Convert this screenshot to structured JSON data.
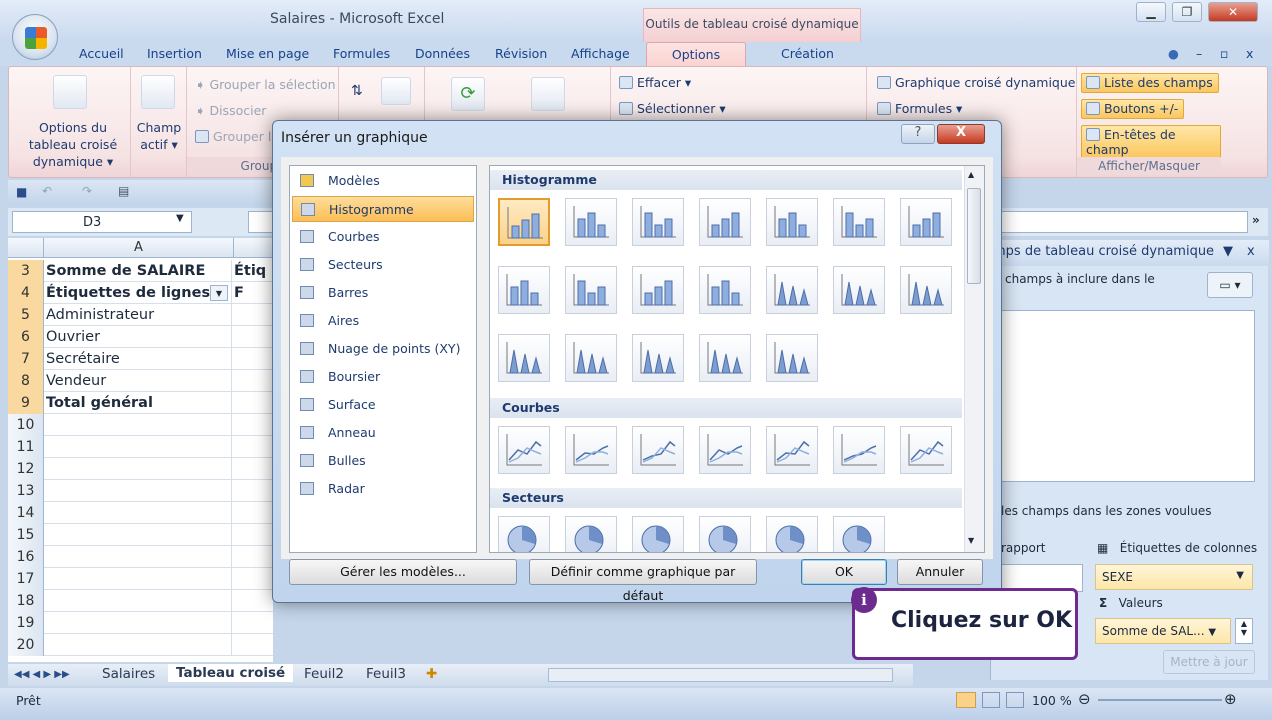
{
  "window": {
    "title": "Salaires - Microsoft Excel",
    "context_tab": "Outils de tableau croisé dynamique"
  },
  "tabs": [
    "Accueil",
    "Insertion",
    "Mise en page",
    "Formules",
    "Données",
    "Révision",
    "Affichage",
    "Options",
    "Création"
  ],
  "ribbon": {
    "options_tableau": "Options du tableau croisé dynamique ▾",
    "champ_actif": "Champ actif ▾",
    "grouper_selection": "Grouper la sélection",
    "dissocier": "Dissocier",
    "grouper": "Grouper le",
    "group_label": "Groupe",
    "effacer": "Effacer ▾",
    "selectionner": "Sélectionner ▾",
    "graphique": "Graphique croisé dynamique",
    "formules": "Formules ▾",
    "liste_champs": "Liste des champs",
    "boutons": "Boutons +/-",
    "entetes": "En-têtes de champ",
    "afficher_masquer": "Afficher/Masquer"
  },
  "formula_bar": {
    "name_box": "D3"
  },
  "sheet": {
    "column": "A",
    "rows": [
      {
        "n": "3",
        "a": "Somme de SALAIRE",
        "b": "Étiq",
        "bold": true
      },
      {
        "n": "4",
        "a": "Étiquettes de lignes",
        "b": "F",
        "bold": true
      },
      {
        "n": "5",
        "a": "Administrateur"
      },
      {
        "n": "6",
        "a": "Ouvrier"
      },
      {
        "n": "7",
        "a": "Secrétaire"
      },
      {
        "n": "8",
        "a": "Vendeur"
      },
      {
        "n": "9",
        "a": "Total général",
        "bold": true
      },
      {
        "n": "10"
      },
      {
        "n": "11"
      },
      {
        "n": "12"
      },
      {
        "n": "13"
      },
      {
        "n": "14"
      },
      {
        "n": "15"
      },
      {
        "n": "16"
      },
      {
        "n": "17"
      },
      {
        "n": "18"
      },
      {
        "n": "19"
      },
      {
        "n": "20"
      }
    ]
  },
  "sheet_tabs": [
    "Salaires",
    "Tableau croisé",
    "Feuil2",
    "Feuil3"
  ],
  "status": {
    "left": "Prêt",
    "zoom": "100 %"
  },
  "pane": {
    "title": "mps de tableau croisé dynamique",
    "choose": "champs à inclure dans le",
    "drag": "les champs dans les zones voulues",
    "rapport": "rapport",
    "col_labels": "Étiquettes de colonnes",
    "col_value": "SEXE",
    "values": "Valeurs",
    "values_value": "Somme de SAL...",
    "update": "Mettre à jour"
  },
  "dialog": {
    "title": "Insérer un graphique",
    "types": [
      "Modèles",
      "Histogramme",
      "Courbes",
      "Secteurs",
      "Barres",
      "Aires",
      "Nuage de points (XY)",
      "Boursier",
      "Surface",
      "Anneau",
      "Bulles",
      "Radar"
    ],
    "selected_type": "Histogramme",
    "sections": [
      {
        "title": "Histogramme",
        "count": 19
      },
      {
        "title": "Courbes",
        "count": 7
      },
      {
        "title": "Secteurs",
        "count": 6
      }
    ],
    "manage": "Gérer les modèles...",
    "set_default": "Définir comme graphique par défaut",
    "ok": "OK",
    "cancel": "Annuler"
  },
  "callout": {
    "text": "Cliquez sur OK",
    "icon": "i"
  },
  "colors": {
    "accent": "#6d2b8f",
    "highlight": "#fbc65c"
  }
}
